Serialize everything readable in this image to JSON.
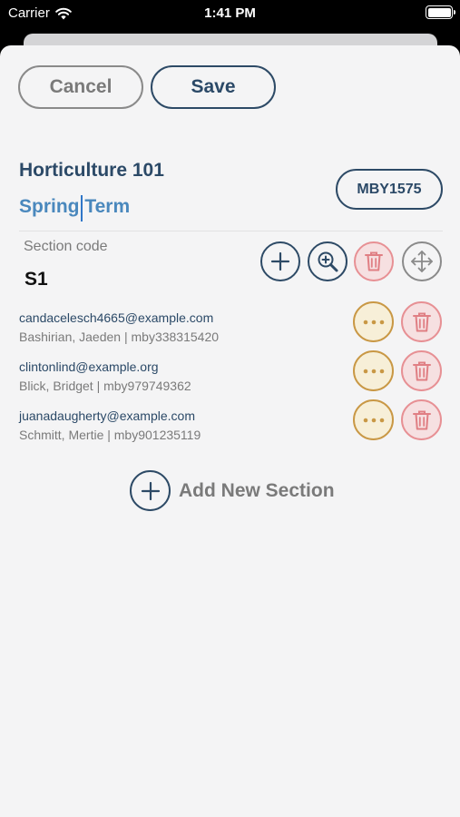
{
  "status_bar": {
    "carrier": "Carrier",
    "time": "1:41 PM"
  },
  "toolbar": {
    "cancel_label": "Cancel",
    "save_label": "Save"
  },
  "course": {
    "title": "Horticulture 101",
    "term": "Spring Term",
    "code": "MBY1575"
  },
  "section": {
    "label": "Section code",
    "value": "S1"
  },
  "members": [
    {
      "email": "candacelesch4665@example.com",
      "meta": "Bashirian, Jaeden | mby338315420"
    },
    {
      "email": "clintonlind@example.org",
      "meta": "Blick, Bridget | mby979749362"
    },
    {
      "email": "juanadaugherty@example.com",
      "meta": "Schmitt, Mertie | mby901235119"
    }
  ],
  "add_section_label": "Add New Section",
  "colors": {
    "navy": "#2b4967",
    "term_blue": "#4a88bd",
    "delete_red": "#e79094",
    "more_gold": "#c99845",
    "sheet": "#f4f4f5"
  },
  "icons": [
    "wifi-icon",
    "battery-icon",
    "plus-icon",
    "zoom-in-icon",
    "trash-icon",
    "move-icon",
    "ellipsis-icon"
  ]
}
